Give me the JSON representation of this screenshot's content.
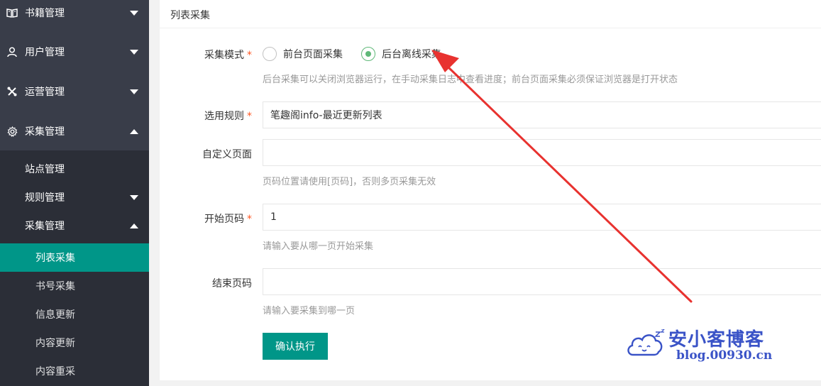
{
  "sidebar": {
    "books": "书籍管理",
    "users": "用户管理",
    "ops": "运营管理",
    "collect": "采集管理",
    "sub": {
      "sites": "站点管理",
      "rules": "规则管理",
      "collect_mgmt": "采集管理",
      "items": [
        "列表采集",
        "书号采集",
        "信息更新",
        "内容更新",
        "内容重采"
      ]
    }
  },
  "card": {
    "title": "列表采集"
  },
  "form": {
    "mode_label": "采集模式",
    "mode_options": [
      "前台页面采集",
      "后台离线采集"
    ],
    "mode_selected": "后台离线采集",
    "mode_help": "后台采集可以关闭浏览器运行，在手动采集日志中查看进度；前台页面采集必须保证浏览器是打开状态",
    "rule_label": "选用规则",
    "rule_value": "笔趣阁info-最近更新列表",
    "custom_label": "自定义页面",
    "custom_value": "",
    "custom_help": "页码位置请使用[页码]，否则多页采集无效",
    "start_label": "开始页码",
    "start_value": "1",
    "start_help": "请输入要从哪一页开始采集",
    "end_label": "结束页码",
    "end_value": "",
    "end_help": "请输入要采集到哪一页",
    "submit": "确认执行",
    "required_mark": "*"
  },
  "watermark": {
    "title": "安小客博客",
    "url": "blog.00930.cn"
  },
  "colors": {
    "sidebar": "#393d49",
    "submenu": "#2b2e37",
    "accent": "#009688",
    "radio": "#5fb878",
    "required": "#ff5722",
    "arrow": "#e8322f",
    "watermark": "#3a53c7"
  }
}
